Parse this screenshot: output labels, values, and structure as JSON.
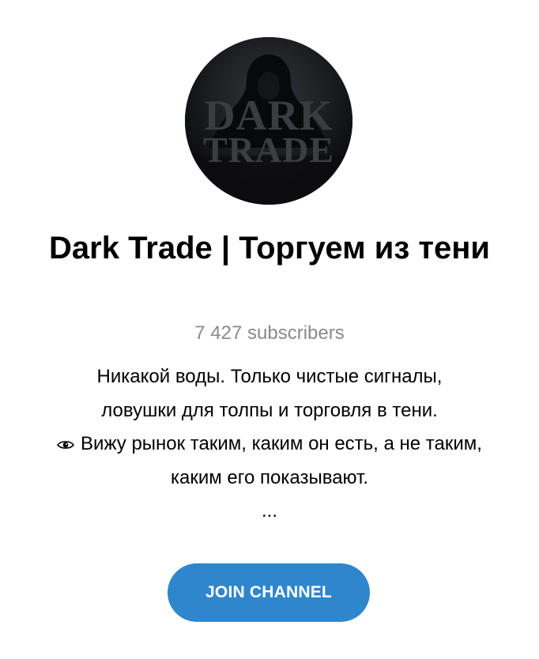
{
  "channel": {
    "avatar": {
      "icon": "hooded-figure-avatar",
      "logo_line1": "DARK",
      "logo_line2": "TRADE"
    },
    "title": "Dark Trade | Торгуем из тени",
    "subscribers": "7 427 subscribers",
    "description": {
      "line1": "Никакой воды. Только чистые сигналы,",
      "line2": "ловушки для толпы и торговля в тени.",
      "line3_icon": "eye-icon",
      "line3": "Вижу рынок таким, каким он есть, а не таким,",
      "line4": "каким его показывают.",
      "more": "..."
    },
    "join_button_label": "JOIN CHANNEL"
  },
  "colors": {
    "background": "#ffffff",
    "title": "#000000",
    "subscribers": "#8a8a8a",
    "button": "#2f86cd",
    "button_text": "#ffffff"
  }
}
